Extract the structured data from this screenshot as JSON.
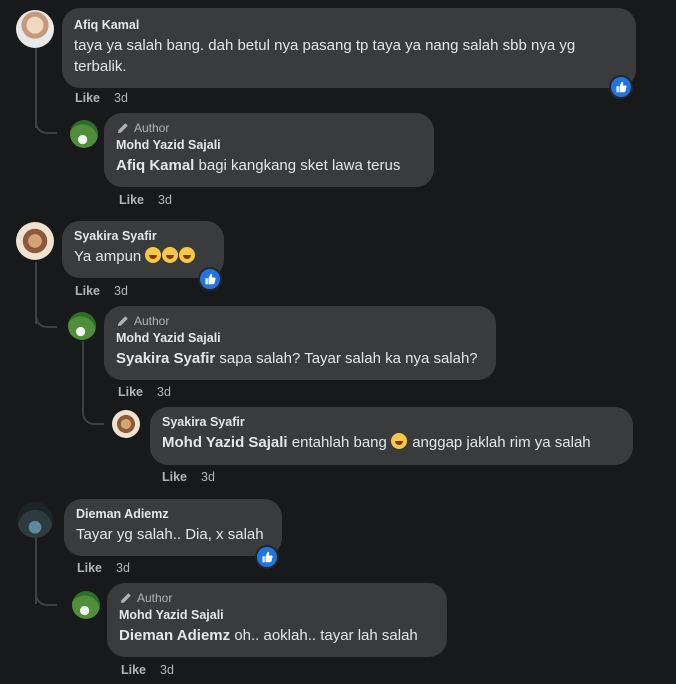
{
  "comments": [
    {
      "author": "Afiq Kamal",
      "text": "taya ya salah bang. dah betul nya pasang tp taya ya nang salah sbb nya yg terbalik.",
      "like_label": "Like",
      "time": "3d",
      "reply": {
        "badge": "Author",
        "author": "Mohd Yazid Sajali",
        "mention": "Afiq Kamal",
        "text": "bagi kangkang sket lawa terus",
        "like_label": "Like",
        "time": "3d"
      }
    },
    {
      "author": "Syakira Syafir",
      "text": "Ya ampun",
      "like_label": "Like",
      "time": "3d",
      "reply": {
        "badge": "Author",
        "author": "Mohd Yazid Sajali",
        "mention": "Syakira Syafir",
        "text": "sapa salah? Tayar salah ka nya salah?",
        "like_label": "Like",
        "time": "3d"
      },
      "nested_reply": {
        "author": "Syakira Syafir",
        "mention": "Mohd Yazid Sajali",
        "text_before": "entahlah bang",
        "text_after": "anggap jaklah rim ya salah",
        "like_label": "Like",
        "time": "3d"
      }
    },
    {
      "author": "Dieman Adiemz",
      "text": "Tayar yg salah.. Dia, x salah",
      "like_label": "Like",
      "time": "3d",
      "reply": {
        "badge": "Author",
        "author": "Mohd Yazid Sajali",
        "mention": "Dieman Adiemz",
        "text": "oh.. aoklah.. tayar lah salah",
        "like_label": "Like",
        "time": "3d"
      }
    }
  ],
  "icons": {
    "reaction": "like-icon",
    "badge": "pencil-icon",
    "emoji": "rolling-laughing-emoji"
  },
  "colors": {
    "background": "#18191a",
    "bubble": "#3a3b3c",
    "reaction": "#2374e1"
  }
}
